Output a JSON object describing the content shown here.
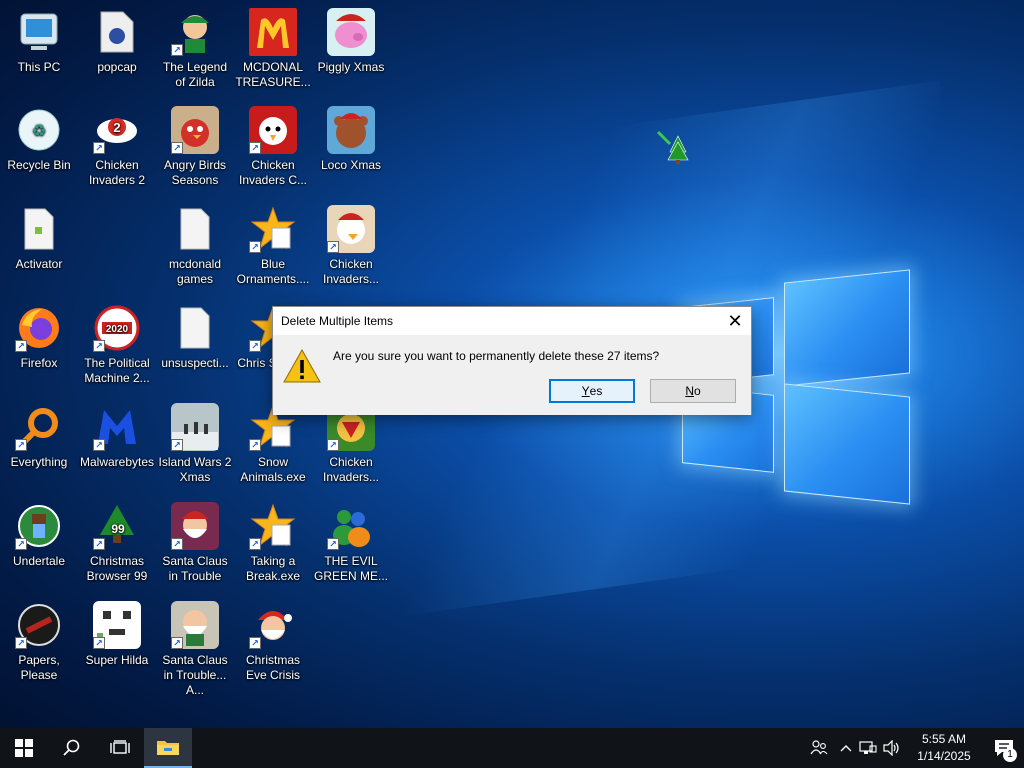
{
  "desktop": {
    "icons": [
      {
        "label": "This PC",
        "icon": "computer-icon"
      },
      {
        "label": "popcap",
        "icon": "folder-icon"
      },
      {
        "label": "The Legend of Zilda",
        "icon": "game-icon"
      },
      {
        "label": "MCDONAL TREASURE...",
        "icon": "mcdonalds-icon"
      },
      {
        "label": "Piggly Xmas",
        "icon": "pig-icon"
      },
      {
        "label": "Recycle Bin",
        "icon": "recycle-bin-icon"
      },
      {
        "label": "Chicken Invaders 2",
        "icon": "chicken-icon"
      },
      {
        "label": "Angry Birds Seasons",
        "icon": "angry-birds-icon"
      },
      {
        "label": "Chicken Invaders C...",
        "icon": "chicken-icon"
      },
      {
        "label": "Loco Xmas",
        "icon": "bear-icon"
      },
      {
        "label": "Activator",
        "icon": "file-icon"
      },
      {
        "label": "mcdonald games",
        "icon": "file-icon"
      },
      {
        "label": "Blue Ornaments....",
        "icon": "star-icon"
      },
      {
        "label": "Chicken Invaders...",
        "icon": "chicken-icon"
      },
      {
        "label": "Firefox",
        "icon": "firefox-icon"
      },
      {
        "label": "The Political Machine 2...",
        "icon": "political-icon"
      },
      {
        "label": "unsuspecti...",
        "icon": "file-icon"
      },
      {
        "label": "Chris Swee...",
        "icon": "star-icon"
      },
      {
        "label": "Everything",
        "icon": "magnifier-icon"
      },
      {
        "label": "Malwarebytes",
        "icon": "malwarebytes-icon"
      },
      {
        "label": "Island Wars 2 Xmas",
        "icon": "island-icon"
      },
      {
        "label": "Snow Animals.exe",
        "icon": "star-icon"
      },
      {
        "label": "Chicken Invaders...",
        "icon": "chicken-icon"
      },
      {
        "label": "Undertale",
        "icon": "undertale-icon"
      },
      {
        "label": "Christmas Browser 99",
        "icon": "tree-icon"
      },
      {
        "label": "Santa Claus in Trouble",
        "icon": "santa-icon"
      },
      {
        "label": "Taking a Break.exe",
        "icon": "star-icon"
      },
      {
        "label": "THE EVIL GREEN ME...",
        "icon": "messenger-icon"
      },
      {
        "label": "Papers, Please",
        "icon": "papers-please-icon"
      },
      {
        "label": "Super Hilda",
        "icon": "pixel-icon"
      },
      {
        "label": "Santa Claus in Trouble... A...",
        "icon": "santa-icon"
      },
      {
        "label": "Christmas Eve Crisis",
        "icon": "santa-icon"
      }
    ]
  },
  "dialog": {
    "title": "Delete Multiple Items",
    "message": "Are you sure you want to permanently delete these 27 items?",
    "yes_label": "Yes",
    "no_label": "No"
  },
  "taskbar": {
    "time": "5:55 AM",
    "date": "1/14/2025",
    "notification_count": "1"
  }
}
